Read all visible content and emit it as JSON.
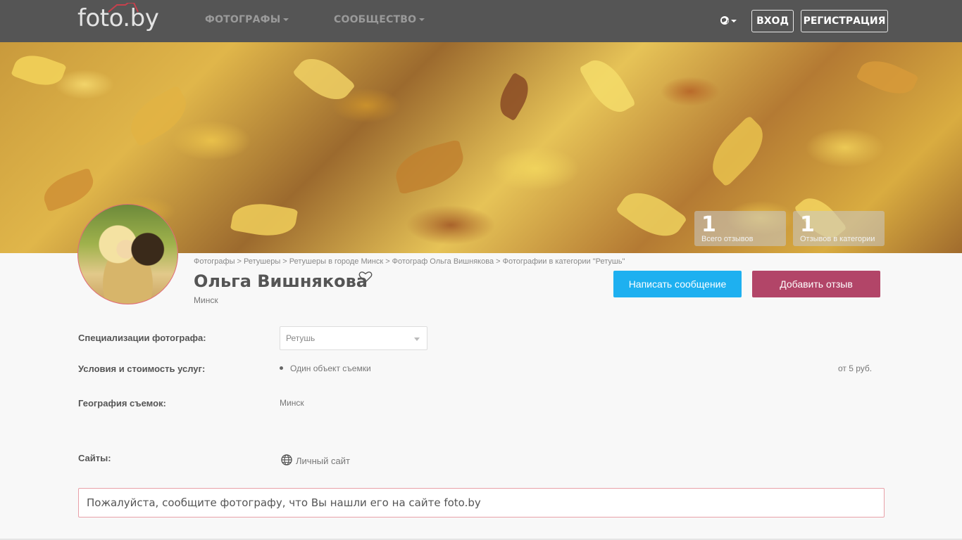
{
  "header": {
    "logo": "foto.by",
    "nav": [
      "ФОТОГРАФЫ",
      "СООБЩЕСТВО"
    ],
    "login": "ВХОД",
    "register": "РЕГИСТРАЦИЯ"
  },
  "stats": [
    {
      "num": "1",
      "label": "Всего отзывов"
    },
    {
      "num": "1",
      "label": "Отзывов в категории"
    }
  ],
  "breadcrumb": "Фотографы > Ретушеры > Ретушеры в городе Минск > Фотограф Ольга Вишнякова > Фотографии в категории \"Ретушь\"",
  "profile": {
    "name": "Ольга Вишнякова",
    "city": "Минск",
    "message_button": "Написать сообщение",
    "review_button": "Добавить отзыв"
  },
  "details": {
    "spec_label": "Специализации фотографа:",
    "spec_value": "Ретушь",
    "terms_label": "Условия и стоимость услуг:",
    "terms_item": "Один объект съемки",
    "terms_price": "от 5 руб.",
    "geo_label": "География съемок:",
    "geo_value": "Минск",
    "sites_label": "Сайты:",
    "sites_value": "Личный сайт"
  },
  "notice": "Пожалуйста, сообщите фотографу, что Вы нашли его на сайте foto.by",
  "icons": [
    "camera-roof-icon",
    "caret-down-icon",
    "globe-icon",
    "heart-icon",
    "web-globe-icon"
  ]
}
